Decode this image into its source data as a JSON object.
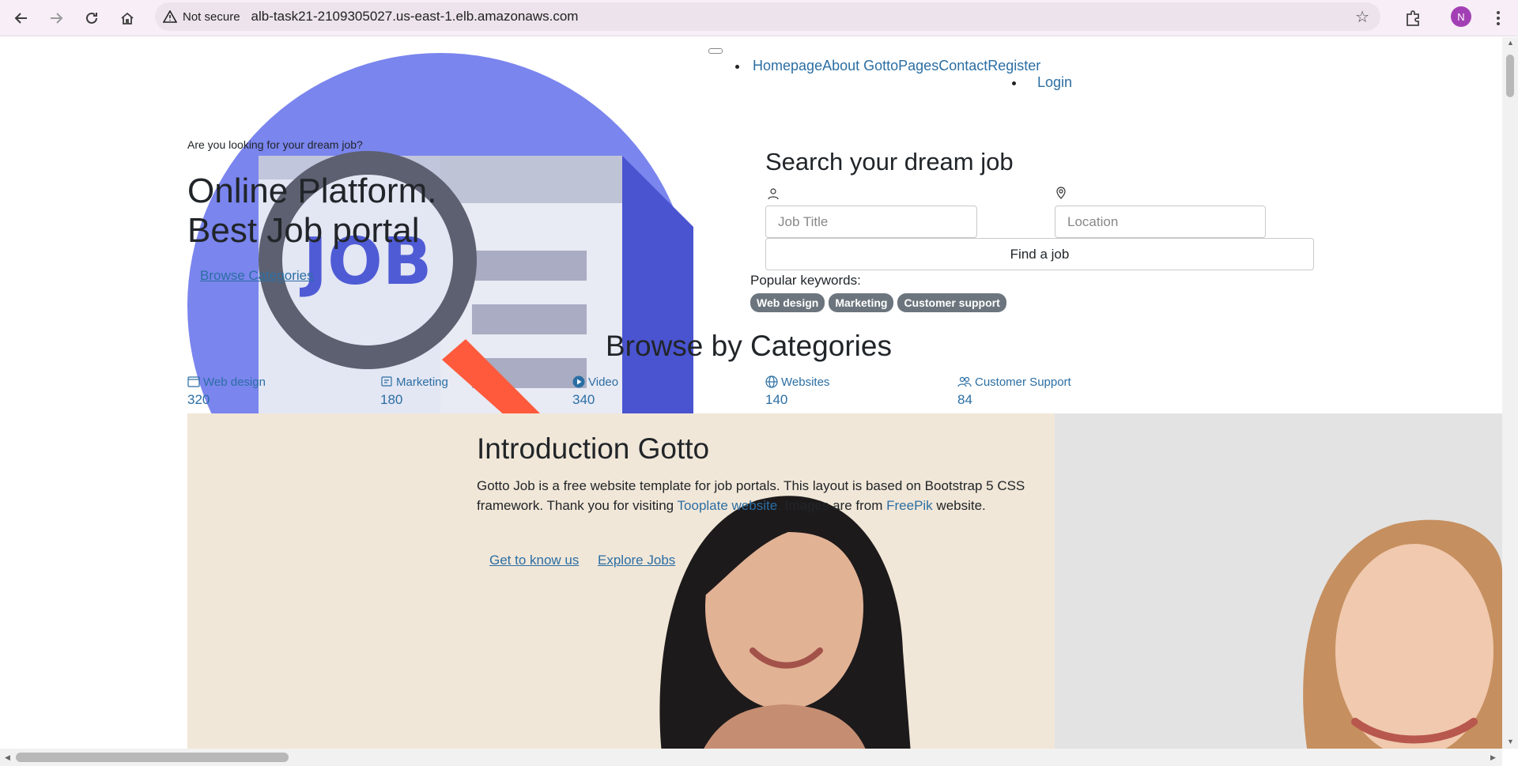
{
  "browser": {
    "security_label": "Not secure",
    "url": "alb-task21-2109305027.us-east-1.elb.amazonaws.com",
    "profile_initial": "N"
  },
  "nav": {
    "items": [
      "Homepage",
      "About Gotto",
      "Pages",
      "Contact",
      "Register"
    ],
    "login": "Login"
  },
  "hero": {
    "subtitle": "Are you looking for your dream job?",
    "title_line1": "Online Platform.",
    "title_line2": "Best Job portal",
    "browse_link": "Browse Categories",
    "art_text": "JOB"
  },
  "search": {
    "title": "Search your dream job",
    "job_title_placeholder": "Job Title",
    "location_placeholder": "Location",
    "button": "Find a job",
    "popular_label": "Popular keywords:",
    "keywords": [
      "Web design",
      "Marketing",
      "Customer support"
    ]
  },
  "categories": {
    "title": "Browse by Categories",
    "items": [
      {
        "label": "Web design",
        "count": "320",
        "icon": "browser-icon"
      },
      {
        "label": "Marketing",
        "count": "180",
        "icon": "megaphone-icon"
      },
      {
        "label": "Video",
        "count": "340",
        "icon": "play-circle-icon"
      },
      {
        "label": "Websites",
        "count": "140",
        "icon": "globe-icon"
      },
      {
        "label": "Customer Support",
        "count": "84",
        "icon": "people-icon"
      }
    ]
  },
  "intro": {
    "title": "Introduction Gotto",
    "text_part1": "Gotto Job is a free website template for job portals. This layout is based on Bootstrap 5 CSS framework. Thank you for visiting ",
    "link1": "Tooplate website",
    "text_part2": ". Images are from ",
    "link2": "FreePik",
    "text_part3": " website.",
    "btn1": "Get to know us",
    "btn2": "Explore Jobs"
  },
  "colors": {
    "link": "#2b6ea3",
    "tag_bg": "#6c757d",
    "intro_bg": "#f1e7d8",
    "hero_circle": "#7a85ee"
  }
}
